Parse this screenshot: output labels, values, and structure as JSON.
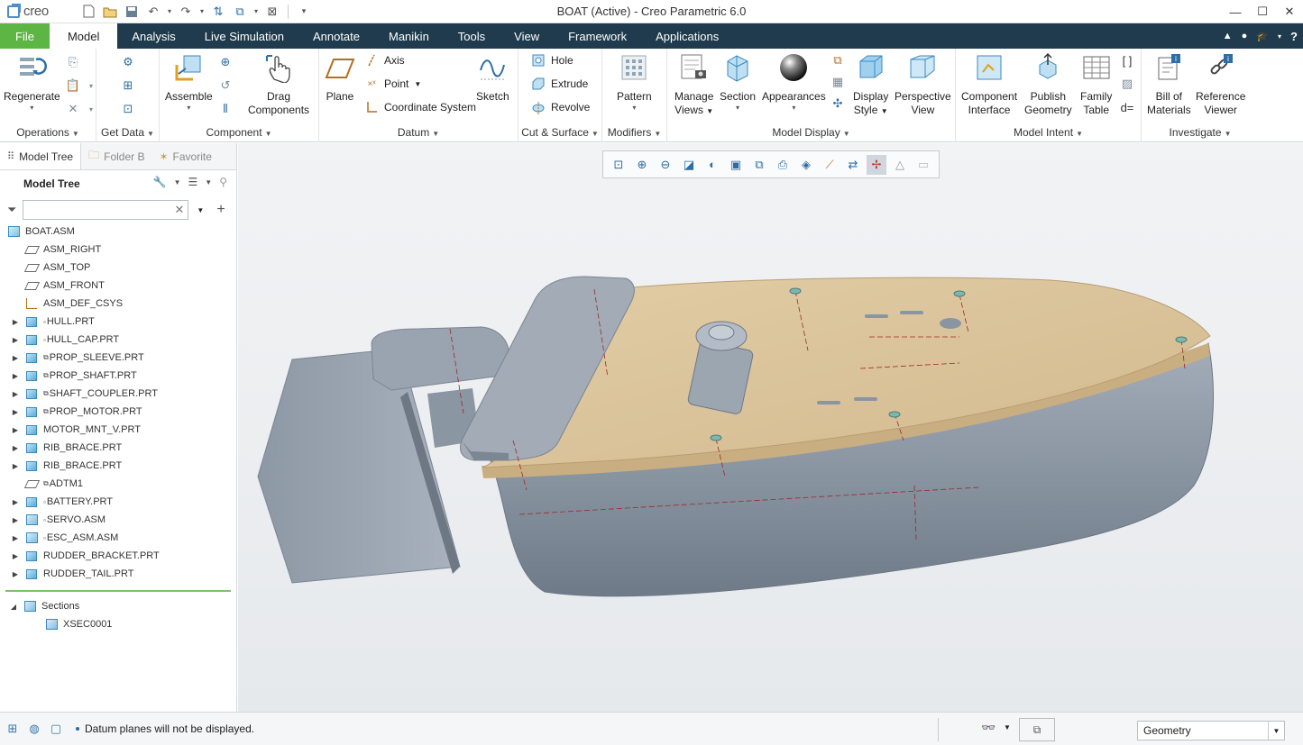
{
  "app": {
    "logo_text": "creo",
    "window_title": "BOAT (Active) - Creo Parametric 6.0"
  },
  "tabs": [
    "File",
    "Model",
    "Analysis",
    "Live Simulation",
    "Annotate",
    "Manikin",
    "Tools",
    "View",
    "Framework",
    "Applications"
  ],
  "active_tab": "Model",
  "ribbon": {
    "operations": {
      "label": "Operations",
      "regenerate": "Regenerate"
    },
    "get_data": {
      "label": "Get Data"
    },
    "component": {
      "label": "Component",
      "assemble": "Assemble",
      "drag_line1": "Drag",
      "drag_line2": "Components"
    },
    "datum": {
      "label": "Datum",
      "plane": "Plane",
      "axis": "Axis",
      "point": "Point",
      "csys": "Coordinate System",
      "sketch": "Sketch"
    },
    "cut_surface": {
      "label": "Cut & Surface",
      "hole": "Hole",
      "extrude": "Extrude",
      "revolve": "Revolve"
    },
    "modifiers": {
      "label": "Modifiers",
      "pattern": "Pattern"
    },
    "model_display": {
      "label": "Model Display",
      "manage_line1": "Manage",
      "manage_line2": "Views",
      "section": "Section",
      "appearances": "Appearances",
      "display_line1": "Display",
      "display_line2": "Style",
      "persp_line1": "Perspective",
      "persp_line2": "View"
    },
    "model_intent": {
      "label": "Model Intent",
      "ci_line1": "Component",
      "ci_line2": "Interface",
      "pg_line1": "Publish",
      "pg_line2": "Geometry",
      "ft_line1": "Family",
      "ft_line2": "Table"
    },
    "investigate": {
      "label": "Investigate",
      "bom_line1": "Bill of",
      "bom_line2": "Materials",
      "rv_line1": "Reference",
      "rv_line2": "Viewer"
    }
  },
  "panel": {
    "tabs": [
      "Model Tree",
      "Folder B",
      "Favorite"
    ],
    "tree_title": "Model Tree",
    "filter_placeholder": "",
    "root": "BOAT.ASM",
    "items": [
      {
        "label": "ASM_RIGHT",
        "type": "plane",
        "expandable": false,
        "mark": ""
      },
      {
        "label": "ASM_TOP",
        "type": "plane",
        "expandable": false,
        "mark": ""
      },
      {
        "label": "ASM_FRONT",
        "type": "plane",
        "expandable": false,
        "mark": ""
      },
      {
        "label": "ASM_DEF_CSYS",
        "type": "csys",
        "expandable": false,
        "mark": ""
      },
      {
        "label": "HULL.PRT",
        "type": "part",
        "expandable": true,
        "mark": "▫"
      },
      {
        "label": "HULL_CAP.PRT",
        "type": "part",
        "expandable": true,
        "mark": "▫"
      },
      {
        "label": "PROP_SLEEVE.PRT",
        "type": "part",
        "expandable": true,
        "mark": "⧉"
      },
      {
        "label": "PROP_SHAFT.PRT",
        "type": "part",
        "expandable": true,
        "mark": "⧉"
      },
      {
        "label": "SHAFT_COUPLER.PRT",
        "type": "part",
        "expandable": true,
        "mark": "⧉"
      },
      {
        "label": "PROP_MOTOR.PRT",
        "type": "part",
        "expandable": true,
        "mark": "⧉"
      },
      {
        "label": "MOTOR_MNT_V.PRT",
        "type": "part",
        "expandable": true,
        "mark": ""
      },
      {
        "label": "RIB_BRACE.PRT",
        "type": "part",
        "expandable": true,
        "mark": ""
      },
      {
        "label": "RIB_BRACE.PRT",
        "type": "part",
        "expandable": true,
        "mark": ""
      },
      {
        "label": "ADTM1",
        "type": "plane",
        "expandable": false,
        "mark": "⧉"
      },
      {
        "label": "BATTERY.PRT",
        "type": "part",
        "expandable": true,
        "mark": "▫"
      },
      {
        "label": "SERVO.ASM",
        "type": "asm",
        "expandable": true,
        "mark": "▫"
      },
      {
        "label": "ESC_ASM.ASM",
        "type": "asm",
        "expandable": true,
        "mark": "▫"
      },
      {
        "label": "RUDDER_BRACKET.PRT",
        "type": "part",
        "expandable": true,
        "mark": ""
      },
      {
        "label": "RUDDER_TAIL.PRT",
        "type": "part",
        "expandable": true,
        "mark": ""
      }
    ],
    "sections_label": "Sections",
    "sections_items": [
      "XSEC0001"
    ]
  },
  "status": {
    "message": "Datum planes will not be displayed.",
    "selection_filter": "Geometry"
  },
  "colors": {
    "tab_bar": "#1f3b4d",
    "file_tab": "#5db544",
    "hull_gray": "#8e99a6",
    "deck_tan": "#d9c29b"
  }
}
